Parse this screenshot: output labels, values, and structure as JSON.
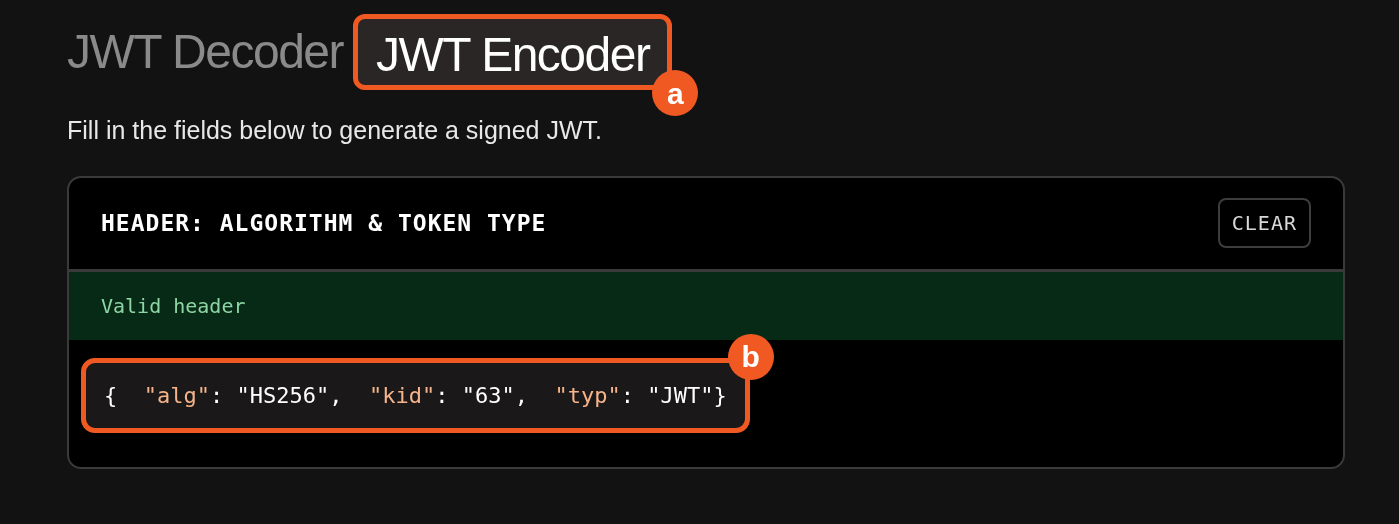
{
  "tabs": [
    {
      "label": "JWT Decoder",
      "selected": false
    },
    {
      "label": "JWT Encoder",
      "selected": true,
      "annotation": "a"
    }
  ],
  "description": "Fill in the fields below to generate a signed JWT.",
  "header_panel": {
    "title": "HEADER: ALGORITHM & TOKEN TYPE",
    "clear_button": "CLEAR",
    "status": {
      "kind": "valid",
      "text": "Valid header"
    },
    "code": {
      "annotation": "b",
      "tokens": [
        {
          "kind": "punct",
          "text": "{  "
        },
        {
          "kind": "key",
          "text": "\"alg\""
        },
        {
          "kind": "punct",
          "text": ": "
        },
        {
          "kind": "string",
          "text": "\"HS256\""
        },
        {
          "kind": "punct",
          "text": ",  "
        },
        {
          "kind": "key",
          "text": "\"kid\""
        },
        {
          "kind": "punct",
          "text": ": "
        },
        {
          "kind": "string",
          "text": "\"63\""
        },
        {
          "kind": "punct",
          "text": ",  "
        },
        {
          "kind": "key",
          "text": "\"typ\""
        },
        {
          "kind": "punct",
          "text": ": "
        },
        {
          "kind": "string",
          "text": "\"JWT\""
        },
        {
          "kind": "punct",
          "text": "}"
        }
      ]
    }
  }
}
